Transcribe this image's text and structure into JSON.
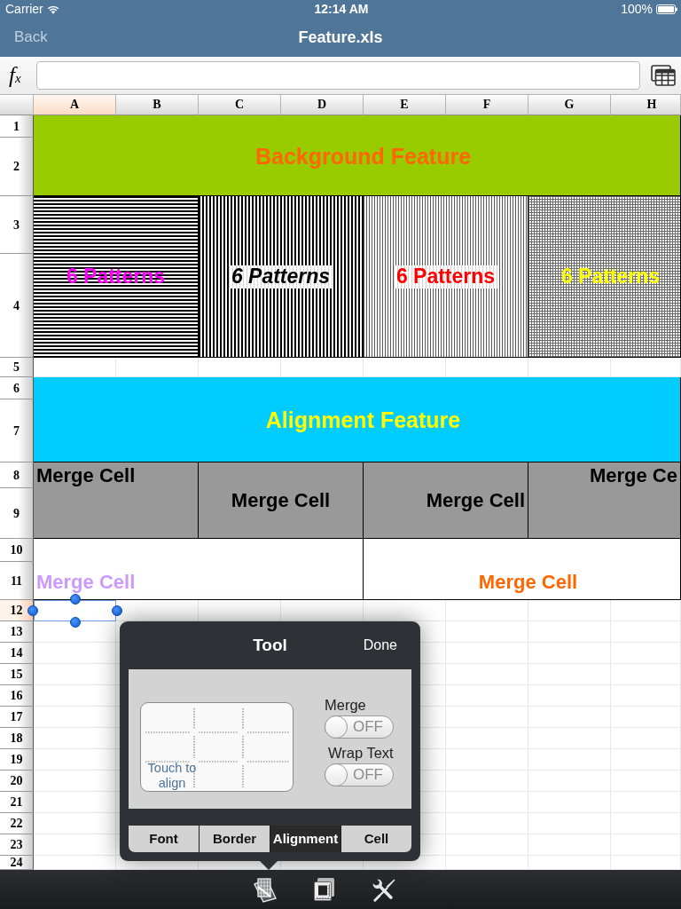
{
  "status_bar": {
    "carrier": "Carrier",
    "time": "12:14 AM",
    "battery": "100%"
  },
  "nav_bar": {
    "back": "Back",
    "title": "Feature.xls"
  },
  "formula_bar": {
    "label": "f$_{x}$"
  },
  "sheet": {
    "columns": [
      {
        "label": "A",
        "selected": true
      },
      {
        "label": "B",
        "selected": false
      },
      {
        "label": "C",
        "selected": false
      },
      {
        "label": "D",
        "selected": false
      },
      {
        "label": "E",
        "selected": false
      },
      {
        "label": "F",
        "selected": false
      },
      {
        "label": "G",
        "selected": false
      },
      {
        "label": "H",
        "selected": false
      }
    ],
    "rows": [
      {
        "label": "1",
        "selected": false
      },
      {
        "label": "2",
        "selected": false
      },
      {
        "label": "3",
        "selected": false
      },
      {
        "label": "4",
        "selected": false
      },
      {
        "label": "5",
        "selected": false
      },
      {
        "label": "6",
        "selected": false
      },
      {
        "label": "7",
        "selected": false
      },
      {
        "label": "8",
        "selected": false
      },
      {
        "label": "9",
        "selected": false
      },
      {
        "label": "10",
        "selected": false
      },
      {
        "label": "11",
        "selected": false
      },
      {
        "label": "12",
        "selected": true
      },
      {
        "label": "13",
        "selected": false
      },
      {
        "label": "14",
        "selected": false
      },
      {
        "label": "15",
        "selected": false
      },
      {
        "label": "16",
        "selected": false
      },
      {
        "label": "17",
        "selected": false
      },
      {
        "label": "18",
        "selected": false
      },
      {
        "label": "19",
        "selected": false
      },
      {
        "label": "20",
        "selected": false
      },
      {
        "label": "21",
        "selected": false
      },
      {
        "label": "22",
        "selected": false
      },
      {
        "label": "23",
        "selected": false
      },
      {
        "label": "24",
        "selected": false
      }
    ],
    "merged_cells": [
      {
        "kind": "solid",
        "color": "#99cc00",
        "label": {
          "text": "Background Feature",
          "color": "#ff6600",
          "italic": false
        }
      },
      {
        "kind": "horizontal",
        "label": {
          "text": "6 Patterns",
          "color": "#ff00ff",
          "italic": false
        }
      },
      {
        "kind": "vertical",
        "label": {
          "text": "6 Patterns",
          "color": "#000000",
          "italic": true
        }
      },
      {
        "kind": "hairline",
        "label": {
          "text": "6 Patterns",
          "color": "#ff0000",
          "italic": false
        }
      },
      {
        "kind": "dotted",
        "label": {
          "text": "6 Patterns",
          "color": "#ffff00",
          "italic": false
        }
      },
      {
        "kind": "solid",
        "color": "#00ccff",
        "label": {
          "text": "Alignment Feature",
          "color": "#ffff00",
          "italic": false
        }
      },
      {
        "kind": "solid",
        "color": "#999999",
        "label": {
          "text": "Merge Cell",
          "color": "#000000",
          "italic": false
        }
      },
      {
        "kind": "solid",
        "color": "#999999",
        "label": {
          "text": "Merge Cell",
          "color": "#000000",
          "italic": false
        }
      },
      {
        "kind": "solid",
        "color": "#999999",
        "label": {
          "text": "Merge Cell",
          "color": "#000000",
          "italic": false
        }
      },
      {
        "kind": "solid",
        "color": "#999999",
        "label": {
          "text": "Merge Ce",
          "color": "#000000",
          "italic": false
        }
      },
      {
        "kind": "solid",
        "color": "#ffffff",
        "label": {
          "text": "Merge Cell",
          "color": "#cc99ff",
          "italic": false
        }
      },
      {
        "kind": "solid",
        "color": "#ffffff",
        "label": {
          "text": "Merge Cell",
          "color": "#ff6600",
          "italic": false
        }
      }
    ]
  },
  "tool_popover": {
    "title": "Tool",
    "done": "Done",
    "align_hint": "Touch to align",
    "switches": [
      {
        "label": "Merge",
        "on": false,
        "state": "OFF"
      },
      {
        "label": "Wrap Text",
        "on": false,
        "state": "OFF"
      }
    ],
    "tabs": [
      {
        "label": "Font",
        "selected": false
      },
      {
        "label": "Border",
        "selected": false
      },
      {
        "label": "Alignment",
        "selected": true
      },
      {
        "label": "Cell",
        "selected": false
      }
    ]
  }
}
